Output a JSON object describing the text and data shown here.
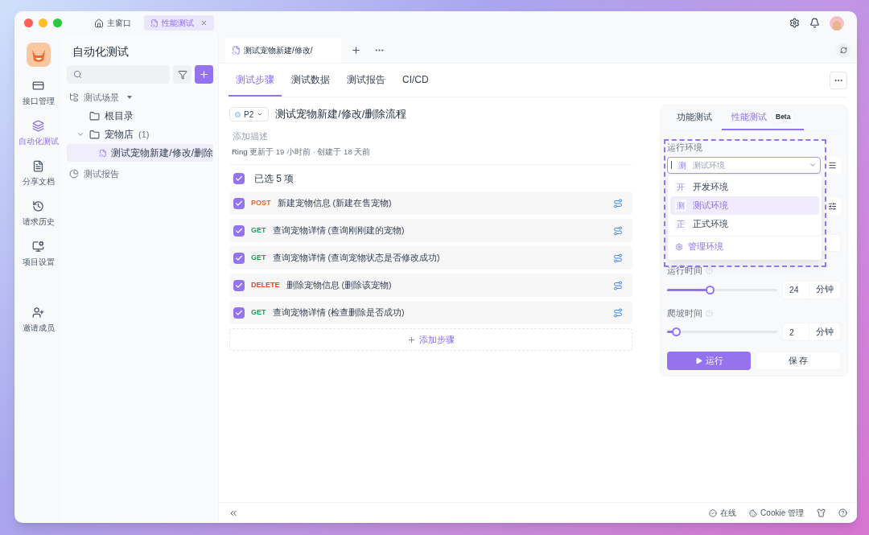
{
  "window_tabs": [
    {
      "label": "主窗口",
      "selected": false,
      "closable": false
    },
    {
      "label": "性能测试",
      "selected": true,
      "closable": true
    }
  ],
  "rail": [
    {
      "label": "接口管理",
      "selected": false,
      "kind": "api"
    },
    {
      "label": "自动化测试",
      "selected": true,
      "kind": "auto"
    },
    {
      "label": "分享文档",
      "selected": false,
      "kind": "doc"
    },
    {
      "label": "请求历史",
      "selected": false,
      "kind": "history"
    },
    {
      "label": "项目设置",
      "selected": false,
      "kind": "settings"
    },
    {
      "label": "邀请成员",
      "selected": false,
      "kind": "invite"
    }
  ],
  "sidebar": {
    "title": "自动化测试",
    "tree_root": "测试场景",
    "tree": [
      {
        "label": "根目录",
        "kind": "folder",
        "expanded": false,
        "selected": false
      },
      {
        "label": "宠物店",
        "count": "(1)",
        "kind": "folder",
        "expanded": true,
        "selected": false,
        "children": [
          {
            "label": "测试宠物新建/修改/删除",
            "kind": "file",
            "selected": true
          }
        ]
      }
    ],
    "report": "测试报告"
  },
  "doc_tab": {
    "label": "测试宠物新建/修改/"
  },
  "tabs": [
    {
      "label": "测试步骤",
      "selected": true
    },
    {
      "label": "测试数据",
      "selected": false
    },
    {
      "label": "测试报告",
      "selected": false
    },
    {
      "label": "CI/CD",
      "selected": false
    }
  ],
  "scenario": {
    "priority": "P2",
    "title": "测试宠物新建/修改/删除流程",
    "description_placeholder": "添加描述",
    "author": "Ring",
    "meta": "更新于 19 小时前 · 创建于 18 天前"
  },
  "select_all": {
    "label": "已选 5 项",
    "checked": true
  },
  "steps": [
    {
      "method": "POST",
      "color": "#f26522",
      "name": "新建宠物信息 (新建在售宠物)",
      "checked": true
    },
    {
      "method": "GET",
      "color": "#17a35a",
      "name": "查询宠物详情 (查询刚刚建的宠物)",
      "checked": true
    },
    {
      "method": "GET",
      "color": "#17a35a",
      "name": "查询宠物详情 (查询宠物状态是否修改成功)",
      "checked": true
    },
    {
      "method": "DELETE",
      "color": "#f0441f",
      "name": "删除宠物信息 (删除该宠物)",
      "checked": true
    },
    {
      "method": "GET",
      "color": "#17a35a",
      "name": "查询宠物详情 (检查删除是否成功)",
      "checked": true
    }
  ],
  "add_step": "添加步骤",
  "run_panel": {
    "tabs": [
      {
        "label": "功能测试",
        "selected": false
      },
      {
        "label": "性能测试",
        "selected": true,
        "badge": "Beta"
      }
    ],
    "env_label": "运行环境",
    "env_value": "测试环境",
    "env_abbr": "测",
    "env_options": [
      {
        "abbr": "开",
        "label": "开发环境",
        "selected": false
      },
      {
        "abbr": "测",
        "label": "测试环境",
        "selected": true
      },
      {
        "abbr": "正",
        "label": "正式环境",
        "selected": false
      }
    ],
    "manage": "管理环境",
    "sliders": [
      {
        "label": "运行时间",
        "level": 0.39,
        "value": "24",
        "unit": "分钟"
      },
      {
        "label": "爬坡时间",
        "level": 0.08,
        "value": "2",
        "unit": "分钟"
      }
    ],
    "run": "运行",
    "save": "保 存"
  },
  "status_bar": {
    "online": "在线",
    "cookie": "Cookie 管理"
  }
}
